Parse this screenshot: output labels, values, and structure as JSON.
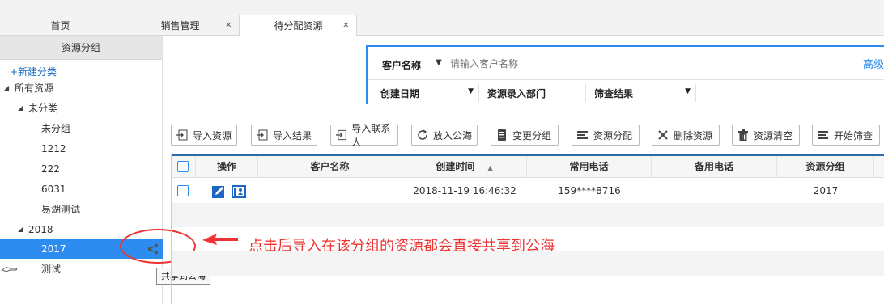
{
  "tabs": [
    {
      "label": "首页",
      "closable": false
    },
    {
      "label": "销售管理",
      "closable": true
    },
    {
      "label": "待分配资源",
      "closable": true,
      "active": true
    }
  ],
  "tab_close_glyph": "×",
  "sidebar": {
    "title": "资源分组",
    "new_category": "+新建分类",
    "items": [
      {
        "label": "所有资源",
        "level": 0,
        "expanded": true
      },
      {
        "label": "未分类",
        "level": 1,
        "expanded": true
      },
      {
        "label": "未分组",
        "level": 2
      },
      {
        "label": "1212",
        "level": 2
      },
      {
        "label": "222",
        "level": 2
      },
      {
        "label": "6031",
        "level": 2
      },
      {
        "label": "易湖测试",
        "level": 2
      },
      {
        "label": "2018",
        "level": 1,
        "expanded": true
      },
      {
        "label": "2017",
        "level": 2,
        "selected": true
      },
      {
        "label": "测试",
        "level": 2
      }
    ],
    "share_tooltip": "共享到公海"
  },
  "annotation": {
    "text": "点击后导入在该分组的资源都会直接共享到公海",
    "color": "#ee3333"
  },
  "search": {
    "customer_label": "客户名称",
    "placeholder": "请输入客户名称",
    "advanced": "高级",
    "filters": [
      "创建日期",
      "资源录入部门",
      "筛查结果"
    ]
  },
  "toolbar": {
    "buttons": [
      {
        "label": "导入资源",
        "icon": "import-icon"
      },
      {
        "label": "导入结果",
        "icon": "import-icon"
      },
      {
        "label": "导入联系人",
        "icon": "import-icon"
      },
      {
        "label": "放入公海",
        "icon": "refresh-icon"
      },
      {
        "label": "变更分组",
        "icon": "doc-icon"
      },
      {
        "label": "资源分配",
        "icon": "list-icon"
      },
      {
        "label": "删除资源",
        "icon": "close-icon"
      },
      {
        "label": "资源清空",
        "icon": "trash-icon"
      },
      {
        "label": "开始筛查",
        "icon": "list-icon"
      }
    ]
  },
  "table": {
    "columns": [
      "操作",
      "客户名称",
      "创建时间",
      "常用电话",
      "备用电话",
      "资源分组"
    ],
    "sort_glyph": "▲",
    "rows": [
      {
        "customer": "",
        "created": "2018-11-19 16:46:32",
        "phone": "159****8716",
        "backup": "",
        "group": "2017"
      }
    ]
  },
  "colors": {
    "accent": "#2d8cf0",
    "selected": "#2d8cf0",
    "header_band": "#2d6ca8"
  }
}
